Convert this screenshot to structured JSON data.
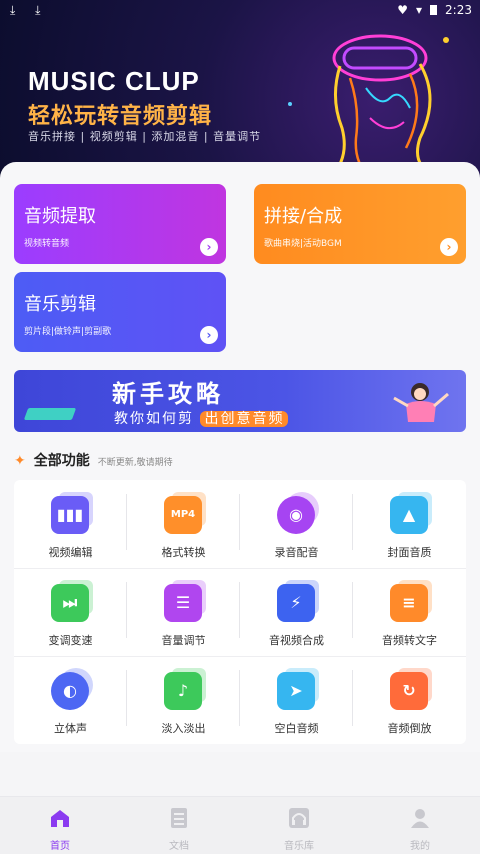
{
  "status_bar": {
    "left_icons": "⤓ ⤓",
    "time": "2:23"
  },
  "hero": {
    "title": "MUSIC CLUP",
    "subtitle": "轻松玩转音频剪辑",
    "tags": "音乐拼接 | 视频剪辑 | 添加混音 | 音量调节"
  },
  "tiles": [
    {
      "title": "音频提取",
      "sub": "视频转音频",
      "go": "›"
    },
    {
      "title": "拼接/合成",
      "sub": "歌曲串烧|活动BGM",
      "go": "›"
    },
    {
      "title": "音乐剪辑",
      "sub": "剪片段|做铃声|剪副歌",
      "go": "›"
    }
  ],
  "guide_banner": {
    "title": "新手攻略",
    "sub_prefix": "教你如何剪",
    "sub_highlight": "出创意音频"
  },
  "features": {
    "title": "全部功能",
    "note": "不断更新,敬请期待",
    "items": [
      {
        "label": "视频编辑",
        "icon": "video-edit-icon",
        "color": "#6a5cf6"
      },
      {
        "label": "格式转换",
        "icon": "mp4-format-icon",
        "color": "#ff8f2a"
      },
      {
        "label": "录音配音",
        "icon": "record-disc-icon",
        "color": "#a644f2"
      },
      {
        "label": "封面音质",
        "icon": "cover-image-icon",
        "color": "#36b6f0"
      },
      {
        "label": "变调变速",
        "icon": "speed-forward-icon",
        "color": "#3dc95b"
      },
      {
        "label": "音量调节",
        "icon": "volume-slider-icon",
        "color": "#b046ef"
      },
      {
        "label": "音视频合成",
        "icon": "av-merge-icon",
        "color": "#3d63f0"
      },
      {
        "label": "音频转文字",
        "icon": "audio-to-text-icon",
        "color": "#ff8a2a"
      },
      {
        "label": "立体声",
        "icon": "stereo-disc-icon",
        "color": "#4d67f3"
      },
      {
        "label": "淡入淡出",
        "icon": "fade-music-icon",
        "color": "#3dc95b"
      },
      {
        "label": "空白音频",
        "icon": "blank-audio-icon",
        "color": "#36b6f0"
      },
      {
        "label": "音频倒放",
        "icon": "reverse-audio-icon",
        "color": "#ff6b3a"
      }
    ]
  },
  "bottom_nav": [
    {
      "label": "首页",
      "icon": "home-icon",
      "active": true
    },
    {
      "label": "文档",
      "icon": "document-icon",
      "active": false
    },
    {
      "label": "音乐库",
      "icon": "headphones-icon",
      "active": false
    },
    {
      "label": "我的",
      "icon": "profile-icon",
      "active": false
    }
  ],
  "colors": {
    "accent": "#8b3bf0",
    "orange": "#ff8b1f",
    "purple": "#9b3dff",
    "blue": "#4d5cf5"
  }
}
